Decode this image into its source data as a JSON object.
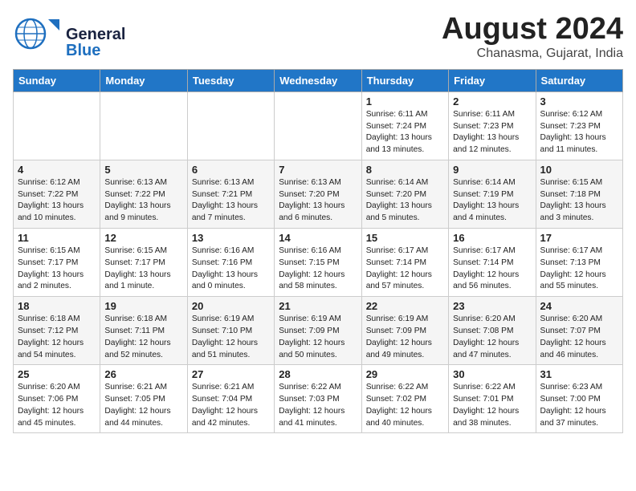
{
  "logo": {
    "line1": "General",
    "line2": "Blue"
  },
  "title": "August 2024",
  "location": "Chanasma, Gujarat, India",
  "days_of_week": [
    "Sunday",
    "Monday",
    "Tuesday",
    "Wednesday",
    "Thursday",
    "Friday",
    "Saturday"
  ],
  "weeks": [
    [
      {
        "day": "",
        "info": ""
      },
      {
        "day": "",
        "info": ""
      },
      {
        "day": "",
        "info": ""
      },
      {
        "day": "",
        "info": ""
      },
      {
        "day": "1",
        "info": "Sunrise: 6:11 AM\nSunset: 7:24 PM\nDaylight: 13 hours\nand 13 minutes."
      },
      {
        "day": "2",
        "info": "Sunrise: 6:11 AM\nSunset: 7:23 PM\nDaylight: 13 hours\nand 12 minutes."
      },
      {
        "day": "3",
        "info": "Sunrise: 6:12 AM\nSunset: 7:23 PM\nDaylight: 13 hours\nand 11 minutes."
      }
    ],
    [
      {
        "day": "4",
        "info": "Sunrise: 6:12 AM\nSunset: 7:22 PM\nDaylight: 13 hours\nand 10 minutes."
      },
      {
        "day": "5",
        "info": "Sunrise: 6:13 AM\nSunset: 7:22 PM\nDaylight: 13 hours\nand 9 minutes."
      },
      {
        "day": "6",
        "info": "Sunrise: 6:13 AM\nSunset: 7:21 PM\nDaylight: 13 hours\nand 7 minutes."
      },
      {
        "day": "7",
        "info": "Sunrise: 6:13 AM\nSunset: 7:20 PM\nDaylight: 13 hours\nand 6 minutes."
      },
      {
        "day": "8",
        "info": "Sunrise: 6:14 AM\nSunset: 7:20 PM\nDaylight: 13 hours\nand 5 minutes."
      },
      {
        "day": "9",
        "info": "Sunrise: 6:14 AM\nSunset: 7:19 PM\nDaylight: 13 hours\nand 4 minutes."
      },
      {
        "day": "10",
        "info": "Sunrise: 6:15 AM\nSunset: 7:18 PM\nDaylight: 13 hours\nand 3 minutes."
      }
    ],
    [
      {
        "day": "11",
        "info": "Sunrise: 6:15 AM\nSunset: 7:17 PM\nDaylight: 13 hours\nand 2 minutes."
      },
      {
        "day": "12",
        "info": "Sunrise: 6:15 AM\nSunset: 7:17 PM\nDaylight: 13 hours\nand 1 minute."
      },
      {
        "day": "13",
        "info": "Sunrise: 6:16 AM\nSunset: 7:16 PM\nDaylight: 13 hours\nand 0 minutes."
      },
      {
        "day": "14",
        "info": "Sunrise: 6:16 AM\nSunset: 7:15 PM\nDaylight: 12 hours\nand 58 minutes."
      },
      {
        "day": "15",
        "info": "Sunrise: 6:17 AM\nSunset: 7:14 PM\nDaylight: 12 hours\nand 57 minutes."
      },
      {
        "day": "16",
        "info": "Sunrise: 6:17 AM\nSunset: 7:14 PM\nDaylight: 12 hours\nand 56 minutes."
      },
      {
        "day": "17",
        "info": "Sunrise: 6:17 AM\nSunset: 7:13 PM\nDaylight: 12 hours\nand 55 minutes."
      }
    ],
    [
      {
        "day": "18",
        "info": "Sunrise: 6:18 AM\nSunset: 7:12 PM\nDaylight: 12 hours\nand 54 minutes."
      },
      {
        "day": "19",
        "info": "Sunrise: 6:18 AM\nSunset: 7:11 PM\nDaylight: 12 hours\nand 52 minutes."
      },
      {
        "day": "20",
        "info": "Sunrise: 6:19 AM\nSunset: 7:10 PM\nDaylight: 12 hours\nand 51 minutes."
      },
      {
        "day": "21",
        "info": "Sunrise: 6:19 AM\nSunset: 7:09 PM\nDaylight: 12 hours\nand 50 minutes."
      },
      {
        "day": "22",
        "info": "Sunrise: 6:19 AM\nSunset: 7:09 PM\nDaylight: 12 hours\nand 49 minutes."
      },
      {
        "day": "23",
        "info": "Sunrise: 6:20 AM\nSunset: 7:08 PM\nDaylight: 12 hours\nand 47 minutes."
      },
      {
        "day": "24",
        "info": "Sunrise: 6:20 AM\nSunset: 7:07 PM\nDaylight: 12 hours\nand 46 minutes."
      }
    ],
    [
      {
        "day": "25",
        "info": "Sunrise: 6:20 AM\nSunset: 7:06 PM\nDaylight: 12 hours\nand 45 minutes."
      },
      {
        "day": "26",
        "info": "Sunrise: 6:21 AM\nSunset: 7:05 PM\nDaylight: 12 hours\nand 44 minutes."
      },
      {
        "day": "27",
        "info": "Sunrise: 6:21 AM\nSunset: 7:04 PM\nDaylight: 12 hours\nand 42 minutes."
      },
      {
        "day": "28",
        "info": "Sunrise: 6:22 AM\nSunset: 7:03 PM\nDaylight: 12 hours\nand 41 minutes."
      },
      {
        "day": "29",
        "info": "Sunrise: 6:22 AM\nSunset: 7:02 PM\nDaylight: 12 hours\nand 40 minutes."
      },
      {
        "day": "30",
        "info": "Sunrise: 6:22 AM\nSunset: 7:01 PM\nDaylight: 12 hours\nand 38 minutes."
      },
      {
        "day": "31",
        "info": "Sunrise: 6:23 AM\nSunset: 7:00 PM\nDaylight: 12 hours\nand 37 minutes."
      }
    ]
  ]
}
